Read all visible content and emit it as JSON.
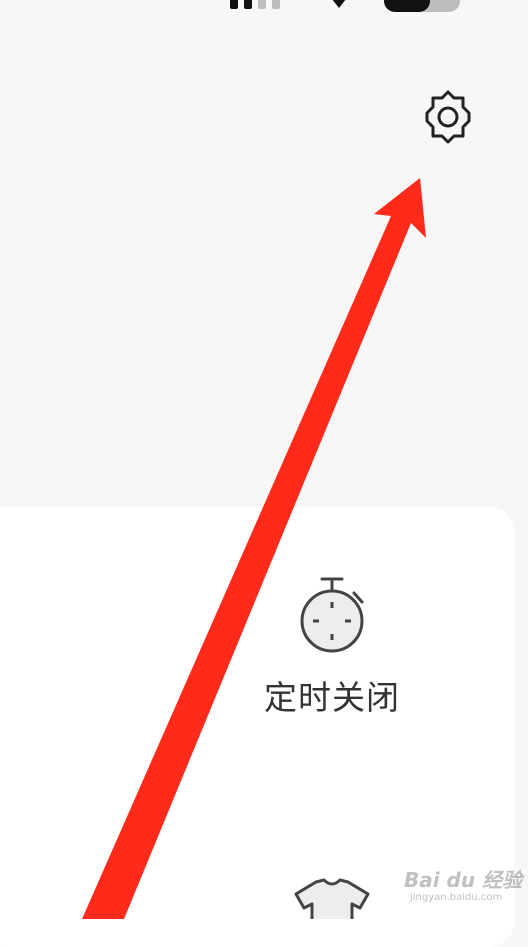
{
  "menu": {
    "timer_label": "定时关闭"
  },
  "icons": {
    "settings": "gear-icon",
    "timer": "stopwatch-icon",
    "theme": "tshirt-icon",
    "signal": "signal-icon",
    "wifi": "wifi-icon",
    "battery": "battery-icon"
  },
  "watermark": {
    "logo": "Bai du 经验",
    "url": "jingyan.baidu.com"
  },
  "colors": {
    "background": "#f7f7f7",
    "card": "#ffffff",
    "annotation_arrow": "#ff2a1a",
    "icon_stroke": "#333333"
  }
}
